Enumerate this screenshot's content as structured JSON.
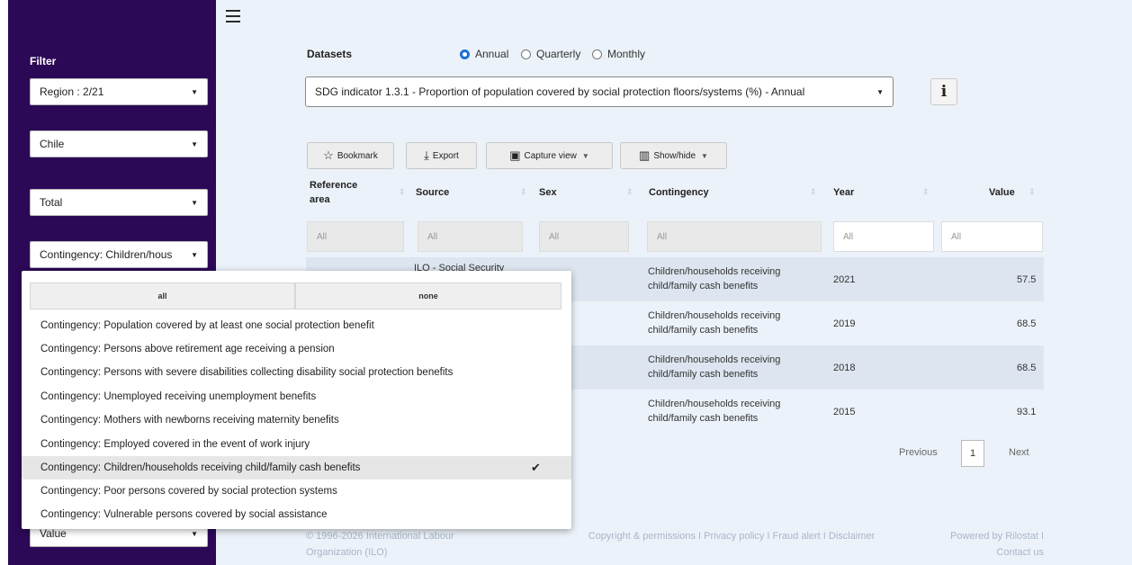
{
  "sidebar": {
    "title": "Filter",
    "filters": [
      {
        "label": "Region : 2/21"
      },
      {
        "label": "Chile"
      },
      {
        "label": "Total"
      },
      {
        "label": "Contingency: Children/hous"
      },
      {
        "label": "Value"
      }
    ]
  },
  "datasets": {
    "label": "Datasets",
    "frequency": [
      {
        "label": "Annual",
        "selected": true
      },
      {
        "label": "Quarterly",
        "selected": false
      },
      {
        "label": "Monthly",
        "selected": false
      }
    ],
    "selected": "SDG indicator 1.3.1 - Proportion of population covered by social protection floors/systems (%) - Annual",
    "info_label": "i"
  },
  "toolbar": {
    "bookmark": "Bookmark",
    "export": "Export",
    "capture": "Capture view",
    "showhide": "Show/hide"
  },
  "table": {
    "headers": [
      "Reference area",
      "Source",
      "Sex",
      "Contingency",
      "Year",
      "Value"
    ],
    "filter_placeholder": "All",
    "rows": [
      {
        "source": "ILO - Social Security",
        "contingency": "Children/households receiving child/family cash benefits",
        "year": "2021",
        "value": "57.5"
      },
      {
        "source": "",
        "contingency": "Children/households receiving child/family cash benefits",
        "year": "2019",
        "value": "68.5"
      },
      {
        "source": "",
        "contingency": "Children/households receiving child/family cash benefits",
        "year": "2018",
        "value": "68.5"
      },
      {
        "source": "",
        "contingency": "Children/households receiving child/family cash benefits",
        "year": "2015",
        "value": "93.1"
      }
    ]
  },
  "pagination": {
    "prev": "Previous",
    "current": "1",
    "next": "Next"
  },
  "footer": {
    "copyright": "© 1996-2026 International Labour Organization (ILO)",
    "links": "Copyright & permissions I Privacy policy I Fraud alert I Disclaimer",
    "powered": "Powered by Rilostat I Contact us"
  },
  "dropdown": {
    "all": "all",
    "none": "none",
    "options": [
      "Contingency: Population covered by at least one social protection benefit",
      "Contingency: Persons above retirement age receiving a pension",
      "Contingency: Persons with severe disabilities collecting disability social protection benefits",
      "Contingency: Unemployed receiving unemployment benefits",
      "Contingency: Mothers with newborns receiving maternity benefits",
      "Contingency: Employed covered in the event of work injury",
      "Contingency: Children/households receiving child/family cash benefits",
      "Contingency: Poor persons covered by social protection systems",
      "Contingency: Vulnerable persons covered by social assistance"
    ],
    "selected_index": 6
  },
  "colors": {
    "sidebar": "#2b0957",
    "main_bg": "#ecf2f9",
    "radio_accent": "#1a6fd6"
  }
}
